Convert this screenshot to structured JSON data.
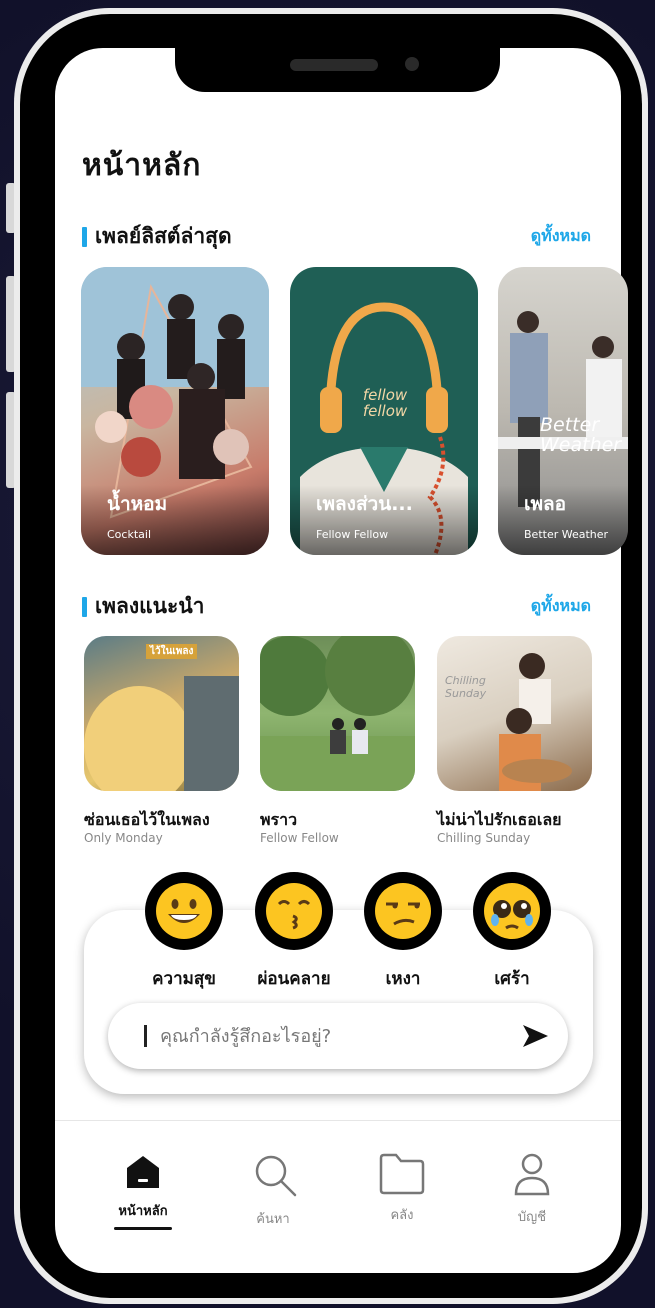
{
  "header": {
    "title": "หน้าหลัก"
  },
  "sections": {
    "playlists": {
      "title": "เพลย์ลิสต์ล่าสุด",
      "see_all": "ดูทั้งหมด"
    },
    "recommended": {
      "title": "เพลงแนะนำ",
      "see_all": "ดูทั้งหมด"
    }
  },
  "playlists": [
    {
      "name": "น้ำหอม",
      "artist": "Cocktail"
    },
    {
      "name": "เพลงส่วน...",
      "artist": "Fellow Fellow",
      "cover_text": "fellow fellow"
    },
    {
      "name": "เพลอ",
      "artist": "Better Weather",
      "cover_text": "Better Weather"
    }
  ],
  "recommended": [
    {
      "name": "ซ่อนเธอไว้ในเพลง",
      "artist": "Only Monday",
      "cover_text": "ไว้ในเพลง"
    },
    {
      "name": "พราว",
      "artist": "Fellow Fellow"
    },
    {
      "name": "ไม่น่าไปรักเธอเลย",
      "artist": "Chilling Sunday",
      "cover_text": "Chilling Sunday"
    }
  ],
  "moods": [
    {
      "label": "ความสุข",
      "icon": "grinning-face-icon"
    },
    {
      "label": "ผ่อนคลาย",
      "icon": "kissing-face-icon"
    },
    {
      "label": "เหงา",
      "icon": "unamused-face-icon"
    },
    {
      "label": "เศร้า",
      "icon": "pleading-face-icon"
    }
  ],
  "mood_input": {
    "placeholder": "คุณกำลังรู้สึกอะไรอยู่?"
  },
  "nav": [
    {
      "label": "หน้าหลัก",
      "icon": "home-icon",
      "active": true
    },
    {
      "label": "ค้นหา",
      "icon": "search-icon"
    },
    {
      "label": "คลัง",
      "icon": "folder-icon"
    },
    {
      "label": "บัญชี",
      "icon": "user-icon"
    }
  ],
  "colors": {
    "accent": "#1ea7e8",
    "text": "#111111",
    "muted": "#888888"
  }
}
